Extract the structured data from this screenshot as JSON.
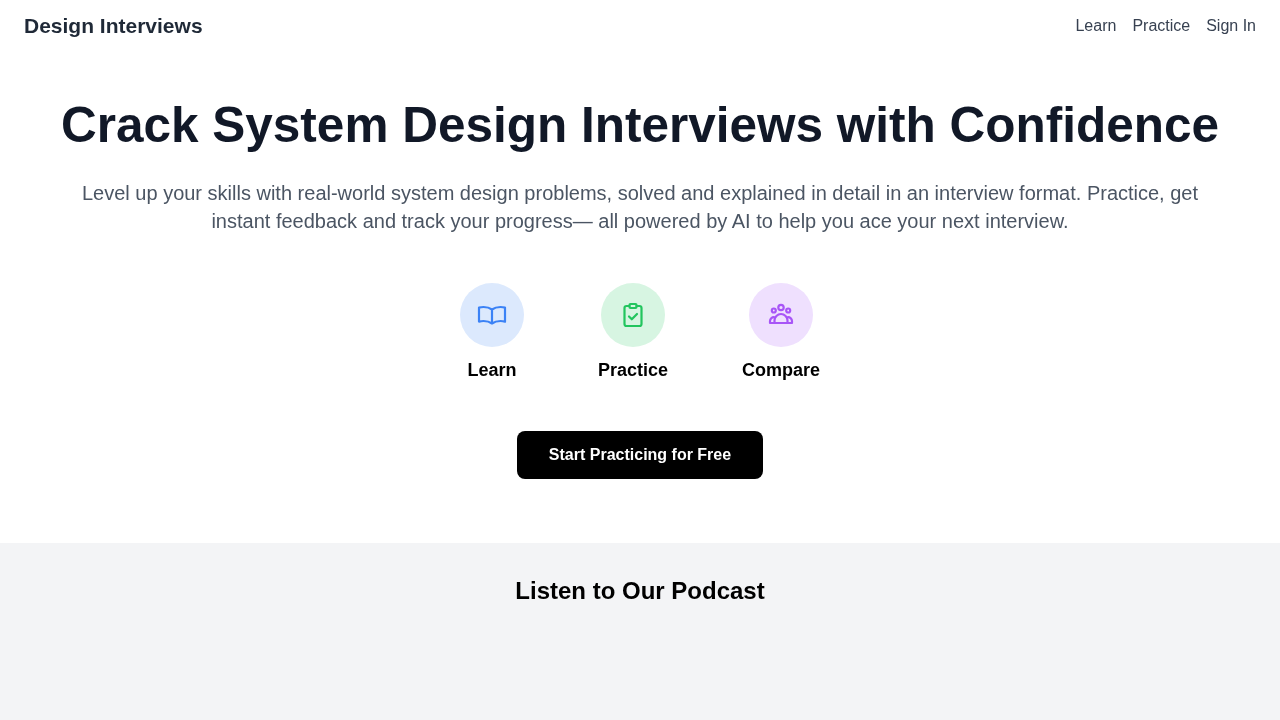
{
  "header": {
    "brand": "Design Interviews",
    "nav": [
      "Learn",
      "Practice",
      "Sign In"
    ]
  },
  "hero": {
    "title": "Crack System Design Interviews with Confidence",
    "subtitle": "Level up your skills with real-world system design problems, solved and explained in detail in an interview format. Practice, get instant feedback and track your progress— all powered by AI to help you ace your next interview.",
    "features": [
      {
        "label": "Learn",
        "kind": "book",
        "color": "#3b82f6"
      },
      {
        "label": "Practice",
        "kind": "clipboard",
        "color": "#22c55e"
      },
      {
        "label": "Compare",
        "kind": "group",
        "color": "#a855f7"
      }
    ],
    "cta": "Start Practicing for Free"
  },
  "podcast": {
    "title": "Listen to Our Podcast"
  }
}
